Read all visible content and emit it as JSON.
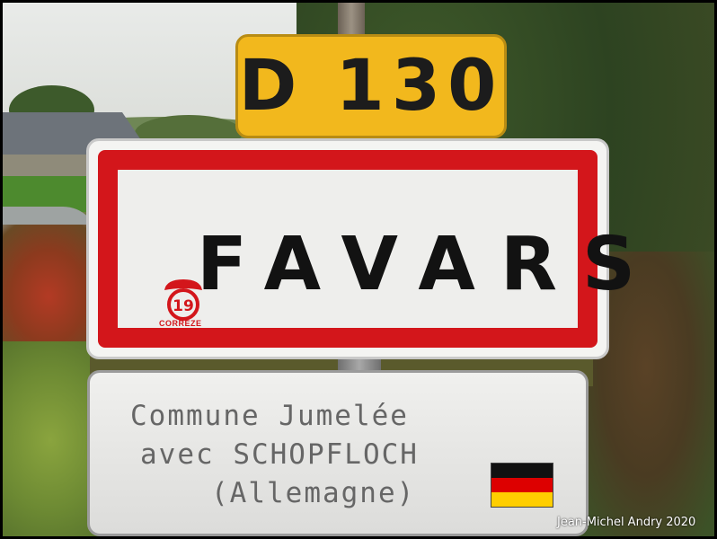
{
  "road_number": "D 130",
  "town_sign": {
    "name": "FAVARS",
    "logo_number": "19",
    "logo_label": "CORREZE"
  },
  "twinning_sign": {
    "line1": "Commune Jumelée",
    "line2": "avec SCHOPFLOCH",
    "line3": "(Allemagne)"
  },
  "flag": {
    "stripes": [
      "#111111",
      "#dd0000",
      "#ffce00"
    ]
  },
  "credit": "Jean-Michel Andry 2020"
}
